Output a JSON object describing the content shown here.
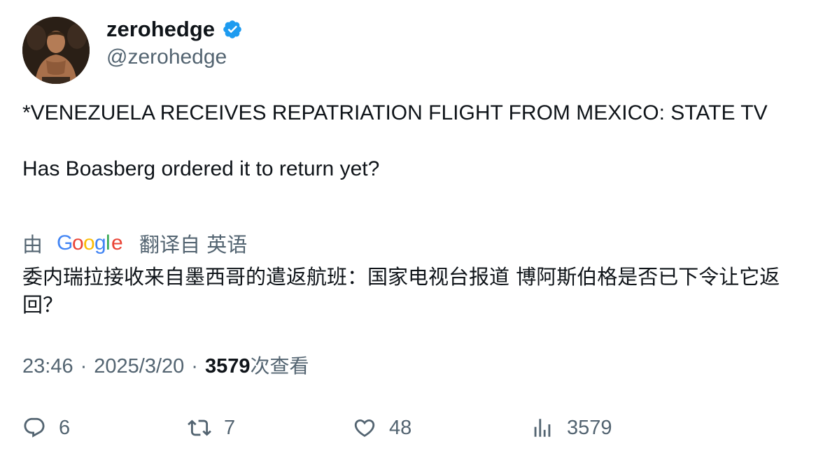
{
  "author": {
    "display_name": "zerohedge",
    "handle": "@zerohedge",
    "verified": true,
    "verified_color": "#1d9bf0"
  },
  "tweet": {
    "text_line_1": "*VENEZUELA RECEIVES REPATRIATION FLIGHT FROM MEXICO: STATE TV",
    "text_line_2": "Has Boasberg ordered it to return yet?"
  },
  "translation": {
    "by_label": "由",
    "provider_letters": [
      "G",
      "o",
      "o",
      "g",
      "l",
      "e"
    ],
    "provider_colors": [
      "#4285f4",
      "#ea4335",
      "#fbbc05",
      "#4285f4",
      "#34a853",
      "#ea4335"
    ],
    "from_label": "翻译自 英语",
    "translated_text": "委内瑞拉接收来自墨西哥的遣返航班：国家电视台报道 博阿斯伯格是否已下令让它返回？"
  },
  "meta": {
    "time": "23:46",
    "separator": "·",
    "date": "2025/3/20",
    "views_count": "3579",
    "views_label": "次查看"
  },
  "actions": {
    "reply_count": "6",
    "retweet_count": "7",
    "like_count": "48",
    "views_count": "3579"
  },
  "colors": {
    "text_primary": "#0f1419",
    "text_secondary": "#536471"
  },
  "icons": {
    "reply": "reply-icon",
    "retweet": "retweet-icon",
    "like": "heart-icon",
    "views": "views-chart-icon",
    "verified": "verified-badge-icon"
  }
}
